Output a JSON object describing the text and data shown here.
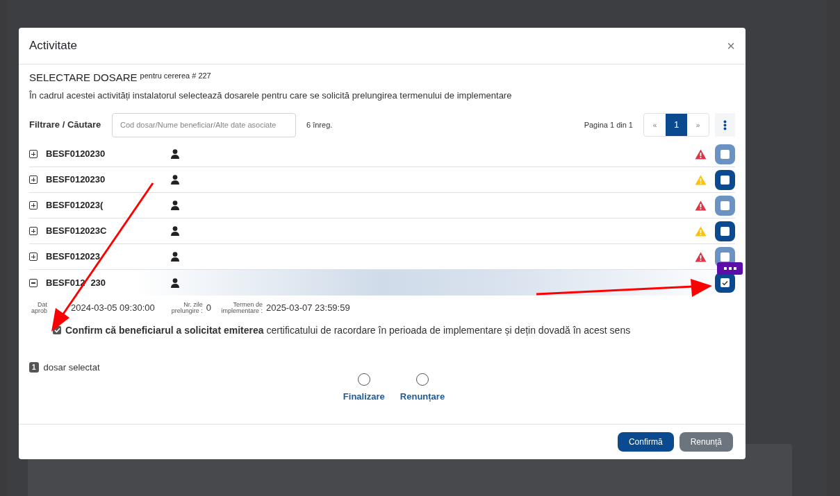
{
  "dialog": {
    "title": "Activitate",
    "close": "×",
    "heading": "SELECTARE DOSARE",
    "heading_note": "pentru cererea # 227",
    "description": "În cadrul acestei activități instalatorul selectează dosarele pentru care se solicită prelungirea termenului de implementare",
    "filter_label": "Filtrare / Căutare",
    "search": {
      "placeholder": "Cod dosar/Nume beneficiar/Alte date asociate"
    },
    "record_count": "6 înreg.",
    "page_info": "Pagina 1 din 1",
    "pagination": [
      {
        "label": "«",
        "selected": false
      },
      {
        "label": "1",
        "selected": true
      },
      {
        "label": "»",
        "selected": false
      }
    ],
    "rows": [
      {
        "code": "BESF0120230",
        "expanded": false,
        "selected": false,
        "warning": {
          "color": "#dc3545"
        },
        "checkbox": {
          "color": "#6a93c3",
          "checked": false
        }
      },
      {
        "code": "BESF0120230",
        "expanded": false,
        "selected": false,
        "warning": {
          "color": "#ffc107"
        },
        "checkbox": {
          "color": "#0b4a8f",
          "checked": false
        }
      },
      {
        "code": "BESF012023(",
        "expanded": false,
        "selected": false,
        "warning": {
          "color": "#dc3545"
        },
        "checkbox": {
          "color": "#6a93c3",
          "checked": false
        }
      },
      {
        "code": "BESF012023C",
        "expanded": false,
        "selected": false,
        "warning": {
          "color": "#ffc107"
        },
        "checkbox": {
          "color": "#0b4a8f",
          "checked": false
        }
      },
      {
        "code": "BESF012023",
        "expanded": false,
        "selected": false,
        "warning": {
          "color": "#dc3545"
        },
        "checkbox": {
          "color": "#6a93c3",
          "checked": false
        }
      },
      {
        "code": "BESF012",
        "code_tail": "230",
        "expanded": true,
        "selected": true,
        "checkbox": {
          "color": "#0b4a8f",
          "checked": true
        },
        "details": [
          {
            "label": "Dat aprob",
            "value": "2024-03-05 09:30:00"
          },
          {
            "label": "Nr. zile prelungire :",
            "value": "0"
          },
          {
            "label": "Termen de implementare :",
            "value": "2025-03-07 23:59:59"
          }
        ],
        "confirm": {
          "checked": true,
          "text": "**Confirm că beneficiarul a solicitat emiterea** certificatului de racordare în perioada de implementare și dețin dovadă în acest sens"
        }
      }
    ],
    "selected_count": "1",
    "selected_label": "dosar selectat",
    "options": [
      {
        "label": "Finalizare",
        "selected": false
      },
      {
        "label": "Renunțare",
        "selected": false
      }
    ],
    "buttons": [
      {
        "label": "Confirmă",
        "kind": "primary"
      },
      {
        "label": "Renunță",
        "kind": "secondary"
      }
    ]
  }
}
